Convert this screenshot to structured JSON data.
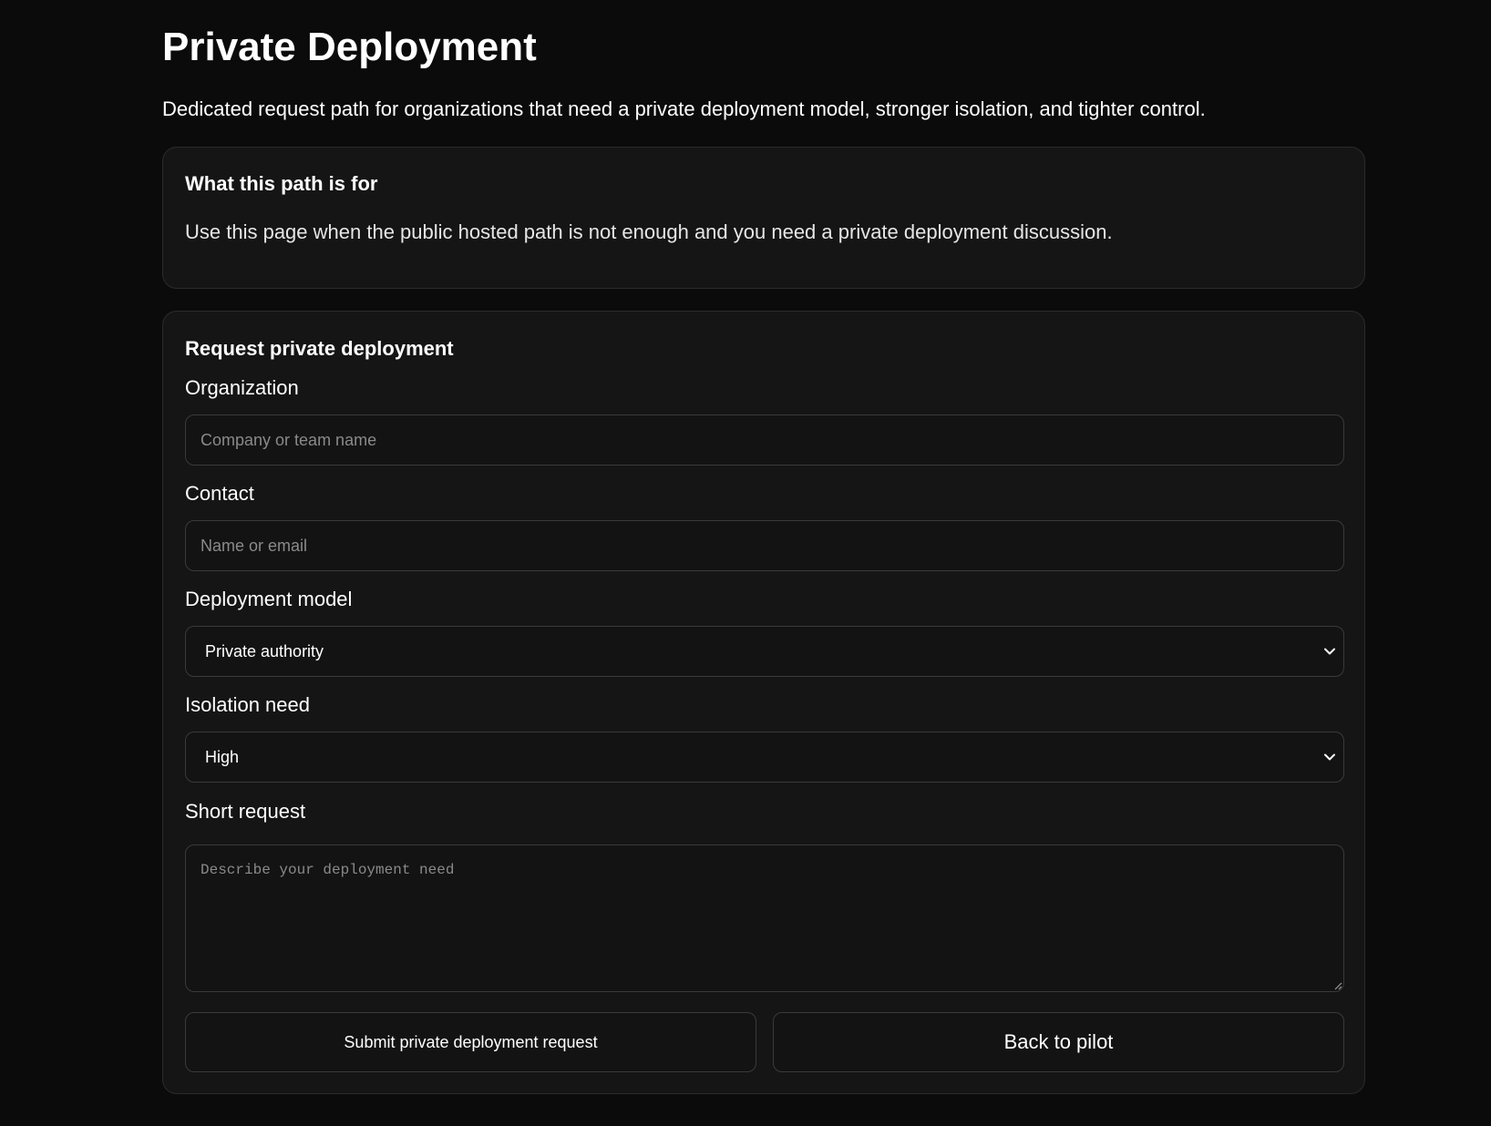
{
  "page": {
    "title": "Private Deployment",
    "subtitle": "Dedicated request path for organizations that need a private deployment model, stronger isolation, and tighter control."
  },
  "info_card": {
    "heading": "What this path is for",
    "text": "Use this page when the public hosted path is not enough and you need a private deployment discussion."
  },
  "form": {
    "heading": "Request private deployment",
    "organization": {
      "label": "Organization",
      "value": "",
      "placeholder": "Company or team name"
    },
    "contact": {
      "label": "Contact",
      "value": "",
      "placeholder": "Name or email"
    },
    "deployment_model": {
      "label": "Deployment model",
      "selected": "Private authority",
      "icon": "chevron-down-icon"
    },
    "isolation_need": {
      "label": "Isolation need",
      "selected": "High",
      "icon": "chevron-down-icon"
    },
    "short_request": {
      "label": "Short request",
      "value": "",
      "placeholder": "Describe your deployment need"
    },
    "submit_label": "Submit private deployment request",
    "back_label": "Back to pilot"
  },
  "colors": {
    "background": "#0b0b0b",
    "card": "#151515",
    "card_border": "#2b2b2b",
    "input_border": "#3a3a3a",
    "text": "#ffffff",
    "placeholder": "#8a8a8a"
  }
}
